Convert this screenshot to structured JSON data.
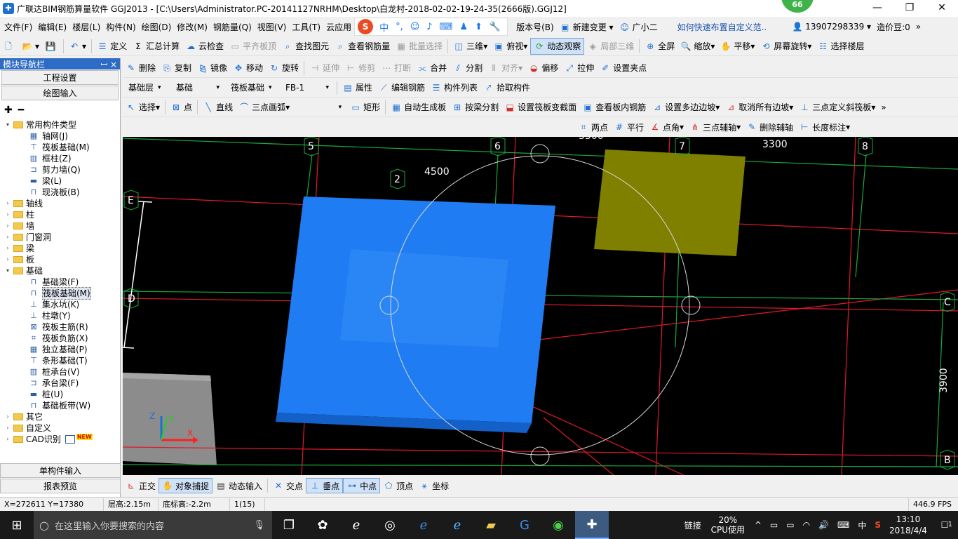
{
  "window": {
    "title": "广联达BIM钢筋算量软件 GGJ2013 - [C:\\Users\\Administrator.PC-20141127NRHM\\Desktop\\白龙村-2018-02-02-19-24-35(2666版).GGJ12]",
    "badge": "66",
    "minimize": "—",
    "restore": "❐",
    "close": "✕"
  },
  "menu": {
    "items": [
      "文件(F)",
      "编辑(E)",
      "楼层(L)",
      "构件(N)",
      "绘图(D)",
      "修改(M)",
      "钢筋量(Q)",
      "视图(V)",
      "工具(T)",
      "云应用"
    ],
    "ime": {
      "logo": "S",
      "mode": "中",
      "punct": "°,"
    },
    "right_items": [
      "版本号(B)",
      "新建变更",
      "广小二"
    ],
    "link": "如何快速布置自定义范..",
    "phone": "13907298339",
    "points": "造价豆:0"
  },
  "toolbar1": {
    "items": [
      "定义",
      "汇总计算",
      "云检查",
      "平齐板顶",
      "查找图元",
      "查看钢筋量",
      "批量选择",
      "三维",
      "俯视",
      "动态观察",
      "局部三维",
      "全屏",
      "缩放",
      "平移",
      "屏幕旋转",
      "选择楼层"
    ]
  },
  "toolbar2": {
    "items": [
      "删除",
      "复制",
      "镜像",
      "移动",
      "旋转",
      "延伸",
      "修剪",
      "打断",
      "合并",
      "分割",
      "对齐",
      "偏移",
      "拉伸",
      "设置夹点"
    ]
  },
  "toolbar3": {
    "floor": "基础层",
    "category": "基础",
    "type": "筏板基础",
    "element": "FB-1",
    "items": [
      "属性",
      "编辑钢筋",
      "构件列表",
      "拾取构件"
    ]
  },
  "toolbar4": {
    "items": [
      "选择",
      "点",
      "直线",
      "三点画弧",
      "矩形",
      "自动生成板",
      "按梁分割",
      "设置筏板变截面",
      "查看板内钢筋",
      "设置多边边坡",
      "取消所有边坡",
      "三点定义斜筏板"
    ]
  },
  "toolbar5": {
    "items": [
      "两点",
      "平行",
      "点角",
      "三点辅轴",
      "删除辅轴",
      "长度标注"
    ]
  },
  "nav": {
    "header": "模块导航栏",
    "pin": "ꟷ",
    "close": "×",
    "btn_settings": "工程设置",
    "btn_draw": "绘图输入",
    "tree": [
      {
        "label": "常用构件类型",
        "level": 0,
        "type": "folder",
        "expanded": true
      },
      {
        "label": "轴网(J)",
        "level": 1,
        "type": "item"
      },
      {
        "label": "筏板基础(M)",
        "level": 1,
        "type": "item"
      },
      {
        "label": "框柱(Z)",
        "level": 1,
        "type": "item"
      },
      {
        "label": "剪力墙(Q)",
        "level": 1,
        "type": "item"
      },
      {
        "label": "梁(L)",
        "level": 1,
        "type": "item"
      },
      {
        "label": "现浇板(B)",
        "level": 1,
        "type": "item"
      },
      {
        "label": "轴线",
        "level": 0,
        "type": "folder",
        "expanded": false
      },
      {
        "label": "柱",
        "level": 0,
        "type": "folder",
        "expanded": false
      },
      {
        "label": "墙",
        "level": 0,
        "type": "folder",
        "expanded": false
      },
      {
        "label": "门窗洞",
        "level": 0,
        "type": "folder",
        "expanded": false
      },
      {
        "label": "梁",
        "level": 0,
        "type": "folder",
        "expanded": false
      },
      {
        "label": "板",
        "level": 0,
        "type": "folder",
        "expanded": false
      },
      {
        "label": "基础",
        "level": 0,
        "type": "folder",
        "expanded": true
      },
      {
        "label": "基础梁(F)",
        "level": 1,
        "type": "item"
      },
      {
        "label": "筏板基础(M)",
        "level": 1,
        "type": "item",
        "selected": true
      },
      {
        "label": "集水坑(K)",
        "level": 1,
        "type": "item"
      },
      {
        "label": "柱墩(Y)",
        "level": 1,
        "type": "item"
      },
      {
        "label": "筏板主筋(R)",
        "level": 1,
        "type": "item"
      },
      {
        "label": "筏板负筋(X)",
        "level": 1,
        "type": "item"
      },
      {
        "label": "独立基础(P)",
        "level": 1,
        "type": "item"
      },
      {
        "label": "条形基础(T)",
        "level": 1,
        "type": "item"
      },
      {
        "label": "桩承台(V)",
        "level": 1,
        "type": "item"
      },
      {
        "label": "承台梁(F)",
        "level": 1,
        "type": "item"
      },
      {
        "label": "桩(U)",
        "level": 1,
        "type": "item"
      },
      {
        "label": "基础板带(W)",
        "level": 1,
        "type": "item"
      },
      {
        "label": "其它",
        "level": 0,
        "type": "folder",
        "expanded": false
      },
      {
        "label": "自定义",
        "level": 0,
        "type": "folder",
        "expanded": false
      },
      {
        "label": "CAD识别",
        "level": 0,
        "type": "folder",
        "expanded": false,
        "new": "NEW"
      }
    ],
    "btn_single": "单构件输入",
    "btn_report": "报表预览"
  },
  "viewport": {
    "axis_labels": [
      "5",
      "6",
      "7",
      "8",
      "2",
      "E",
      "D",
      "C",
      "B"
    ],
    "dims": [
      "4500",
      "3300",
      "3300",
      "3900",
      "3300"
    ],
    "axes_triad": {
      "x": "X",
      "y": "Y",
      "z": "Z"
    },
    "colors": {
      "slab_blue": "#1f7cf2",
      "slab_yellow": "#7f7f00",
      "grid_red": "#e0192b",
      "grid_green": "#1aa83c",
      "slab_gray": "#8c8c8c"
    }
  },
  "snapbar": {
    "items": [
      "正交",
      "对象捕捉",
      "动态输入",
      "交点",
      "垂点",
      "中点",
      "顶点",
      "坐标"
    ]
  },
  "status": {
    "coords": "X=272611 Y=17380",
    "floor_height": "层高:2.15m",
    "bottom_height": "底标高:-2.2m",
    "count": "1(15)",
    "fps": "446.9 FPS"
  },
  "taskbar": {
    "search_placeholder": "在这里输入你要搜索的内容",
    "network_label": "链接",
    "cpu_pct": "20%",
    "cpu_label": "CPU使用",
    "ime": "中",
    "time": "13:10",
    "date": "2018/4/4",
    "notif": "1"
  }
}
